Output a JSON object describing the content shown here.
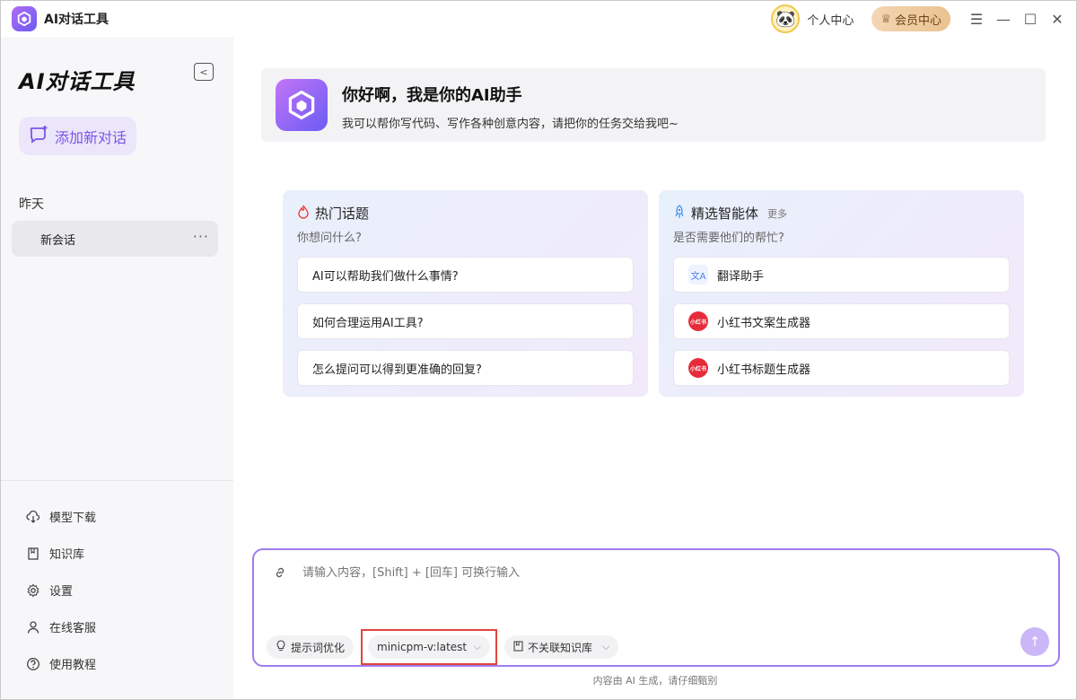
{
  "app": {
    "title": "AI对话工具"
  },
  "header": {
    "personal_center": "个人中心",
    "vip": "会员中心"
  },
  "sidebar": {
    "brand": "AI对话工具",
    "new_chat": "添加新对话",
    "group": "昨天",
    "conversations": [
      {
        "title": "新会话",
        "more": "···"
      }
    ],
    "nav": [
      {
        "label": "模型下载",
        "icon": "cloud-download-icon"
      },
      {
        "label": "知识库",
        "icon": "book-icon"
      },
      {
        "label": "设置",
        "icon": "gear-icon"
      },
      {
        "label": "在线客服",
        "icon": "user-icon"
      },
      {
        "label": "使用教程",
        "icon": "help-icon"
      }
    ]
  },
  "welcome": {
    "title": "你好啊，我是你的AI助手",
    "subtitle": "我可以帮你写代码、写作各种创意内容，请把你的任务交给我吧~"
  },
  "hot_topics": {
    "title": "热门话题",
    "subtitle": "你想问什么?",
    "items": [
      "AI可以帮助我们做什么事情?",
      "如何合理运用AI工具?",
      "怎么提问可以得到更准确的回复?"
    ]
  },
  "agents": {
    "title": "精选智能体",
    "more": "更多",
    "subtitle": "是否需要他们的帮忙?",
    "items": [
      {
        "label": "翻译助手",
        "badge": "文A"
      },
      {
        "label": "小红书文案生成器",
        "badge": "小红书"
      },
      {
        "label": "小红书标题生成器",
        "badge": "小红书"
      }
    ]
  },
  "input": {
    "placeholder": "请输入内容，[Shift] + [回车] 可换行输入",
    "prompt_opt": "提示词优化",
    "model": "minicpm-v:latest",
    "knowledge": "不关联知识库"
  },
  "footer": {
    "note": "内容由 AI 生成，请仔细甄别"
  },
  "colors": {
    "accent": "#7a55e6",
    "highlight": "#e0463c"
  }
}
